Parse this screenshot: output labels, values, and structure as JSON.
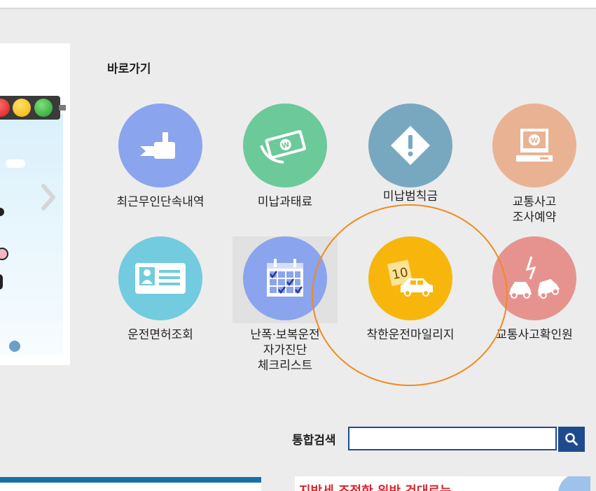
{
  "shortcuts": {
    "title": "바로가기",
    "items": [
      {
        "label": "최근무인단속내역",
        "color": "#8aa4ee",
        "icon": "camera-icon"
      },
      {
        "label": "미납과태료",
        "color": "#6cc99a",
        "icon": "money-icon"
      },
      {
        "label": "미납범칙금",
        "color": "#78a8c0",
        "icon": "warning-icon"
      },
      {
        "label": "교통사고\n조사예약",
        "color": "#e9b393",
        "icon": "monitor-icon"
      },
      {
        "label": "운전면허조회",
        "color": "#72cbde",
        "icon": "license-card-icon"
      },
      {
        "label": "난폭·보복운전\n자가진단\n체크리스트",
        "color": "#8aa4ee",
        "icon": "calendar-checklist-icon"
      },
      {
        "label": "착한운전마일리지",
        "color": "#f8b60d",
        "icon": "car-mileage-icon"
      },
      {
        "label": "교통사고확인원",
        "color": "#e69390",
        "icon": "car-crash-icon"
      }
    ]
  },
  "banner": {
    "mileage_badge": "10"
  },
  "search": {
    "label": "통합검색",
    "value": ""
  },
  "bottom_notice": "지방세 조정한 위반 건대로는",
  "colors": {
    "accent_blue": "#1f4b8e",
    "highlight_ring": "#f28a1c",
    "background": "#ececec"
  }
}
